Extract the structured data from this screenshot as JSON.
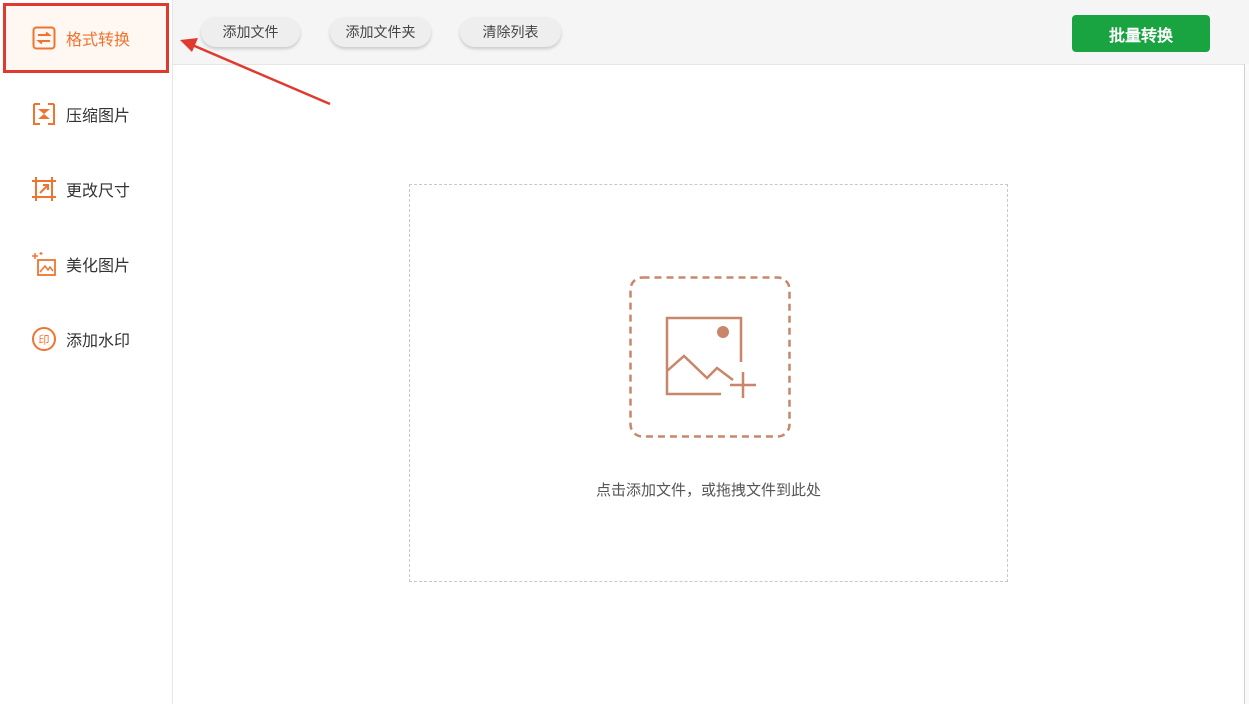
{
  "sidebar": {
    "items": [
      {
        "label": "格式转换",
        "icon": "swap-arrows-icon",
        "active": true
      },
      {
        "label": "压缩图片",
        "icon": "compress-icon",
        "active": false
      },
      {
        "label": "更改尺寸",
        "icon": "resize-icon",
        "active": false
      },
      {
        "label": "美化图片",
        "icon": "beautify-icon",
        "active": false
      },
      {
        "label": "添加水印",
        "icon": "watermark-stamp-icon",
        "active": false
      }
    ]
  },
  "toolbar": {
    "add_file": "添加文件",
    "add_folder": "添加文件夹",
    "clear_list": "清除列表",
    "batch_convert": "批量转换"
  },
  "dropzone": {
    "icon": "add-image-icon",
    "hint": "点击添加文件，或拖拽文件到此处"
  },
  "colors": {
    "accent": "#f0742f",
    "primary_button": "#19a341",
    "highlight_box": "#e03a2e",
    "drop_icon": "#c8866a"
  }
}
